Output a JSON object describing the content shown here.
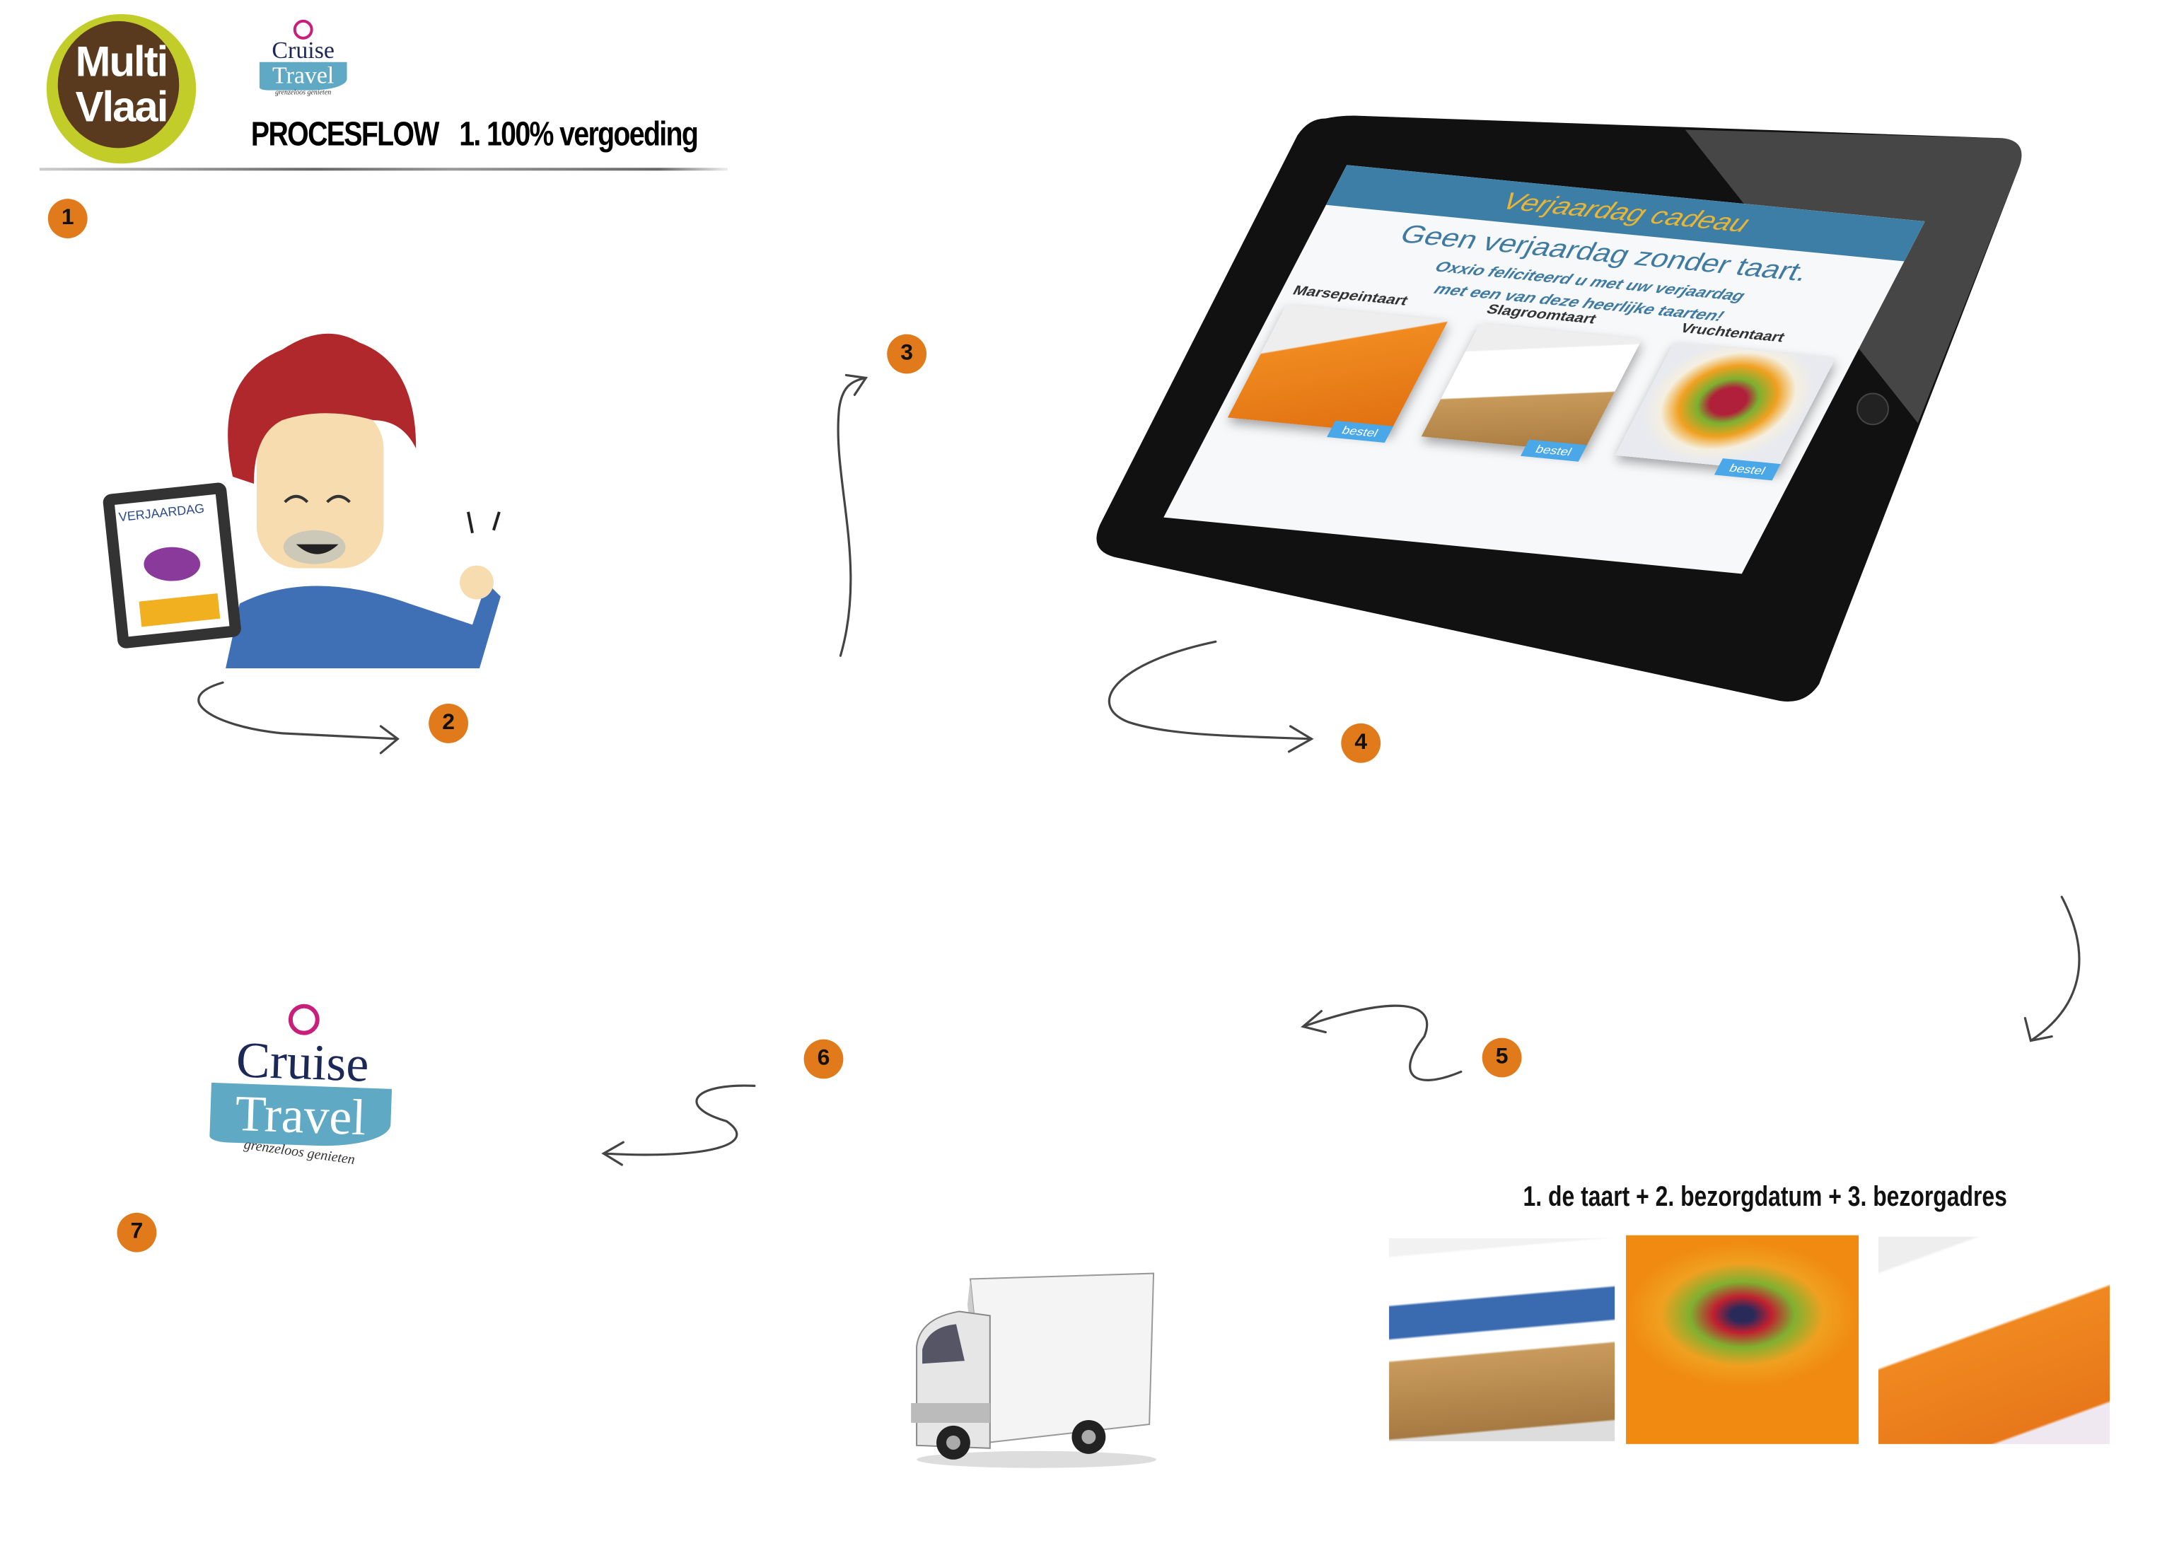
{
  "header": {
    "logo_multivlaai": [
      "Multi",
      "Vlaai"
    ],
    "logo_cruise_small": {
      "line1": "Cruise",
      "line2": "Travel",
      "tagline": "grenzeloos genieten"
    },
    "title": "PROCESFLOW",
    "subtitle": "1. 100% vergoeding"
  },
  "steps": [
    "1",
    "2",
    "3",
    "4",
    "5",
    "6",
    "7"
  ],
  "character": {
    "tablet_label": "VERJAARDAG"
  },
  "tablet": {
    "header": "Verjaardag cadeau",
    "headline": "Geen verjaardag zonder taart.",
    "subline1": "Oxxio feliciteerd u met uw verjaardag",
    "subline2": "met een van deze heerlijke taarten!",
    "products": [
      {
        "name": "Marsepeintaart",
        "button": "bestel"
      },
      {
        "name": "Slagroomtaart",
        "button": "bestel"
      },
      {
        "name": "Vruchtentaart",
        "button": "bestel"
      }
    ]
  },
  "order": {
    "caption": "1. de taart + 2. bezorgdatum + 3. bezorgadres"
  },
  "logo_cruise_large": {
    "line1": "Cruise",
    "line2": "Travel",
    "tagline": "grenzeloos genieten"
  },
  "colors": {
    "badge": "#e07a1a",
    "tablet_header": "#3d7ea6",
    "cruise_blue": "#5fa9c4",
    "multivlaai_green": "#c3cd2a"
  }
}
